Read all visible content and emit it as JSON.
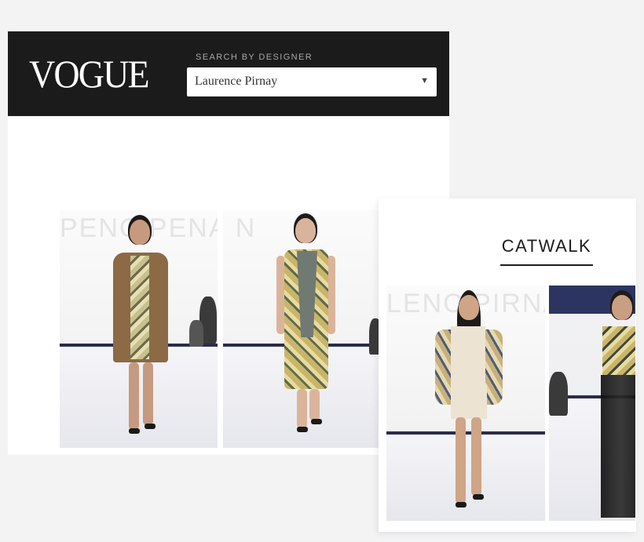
{
  "header": {
    "logo": "VOGUE",
    "search_label": "SEARCH BY DESIGNER",
    "designer_select": {
      "value": "Laurence Pirnay",
      "caret": "▼"
    }
  },
  "catwalk": {
    "title": "CATWALK"
  },
  "backdrop_text": [
    "PENC   PENAT",
    "LENC PIRNA"
  ],
  "colors": {
    "header_bg": "#1c1b1b",
    "page_bg": "#f3f3f4",
    "stage_accent": "#2a2c4a"
  }
}
